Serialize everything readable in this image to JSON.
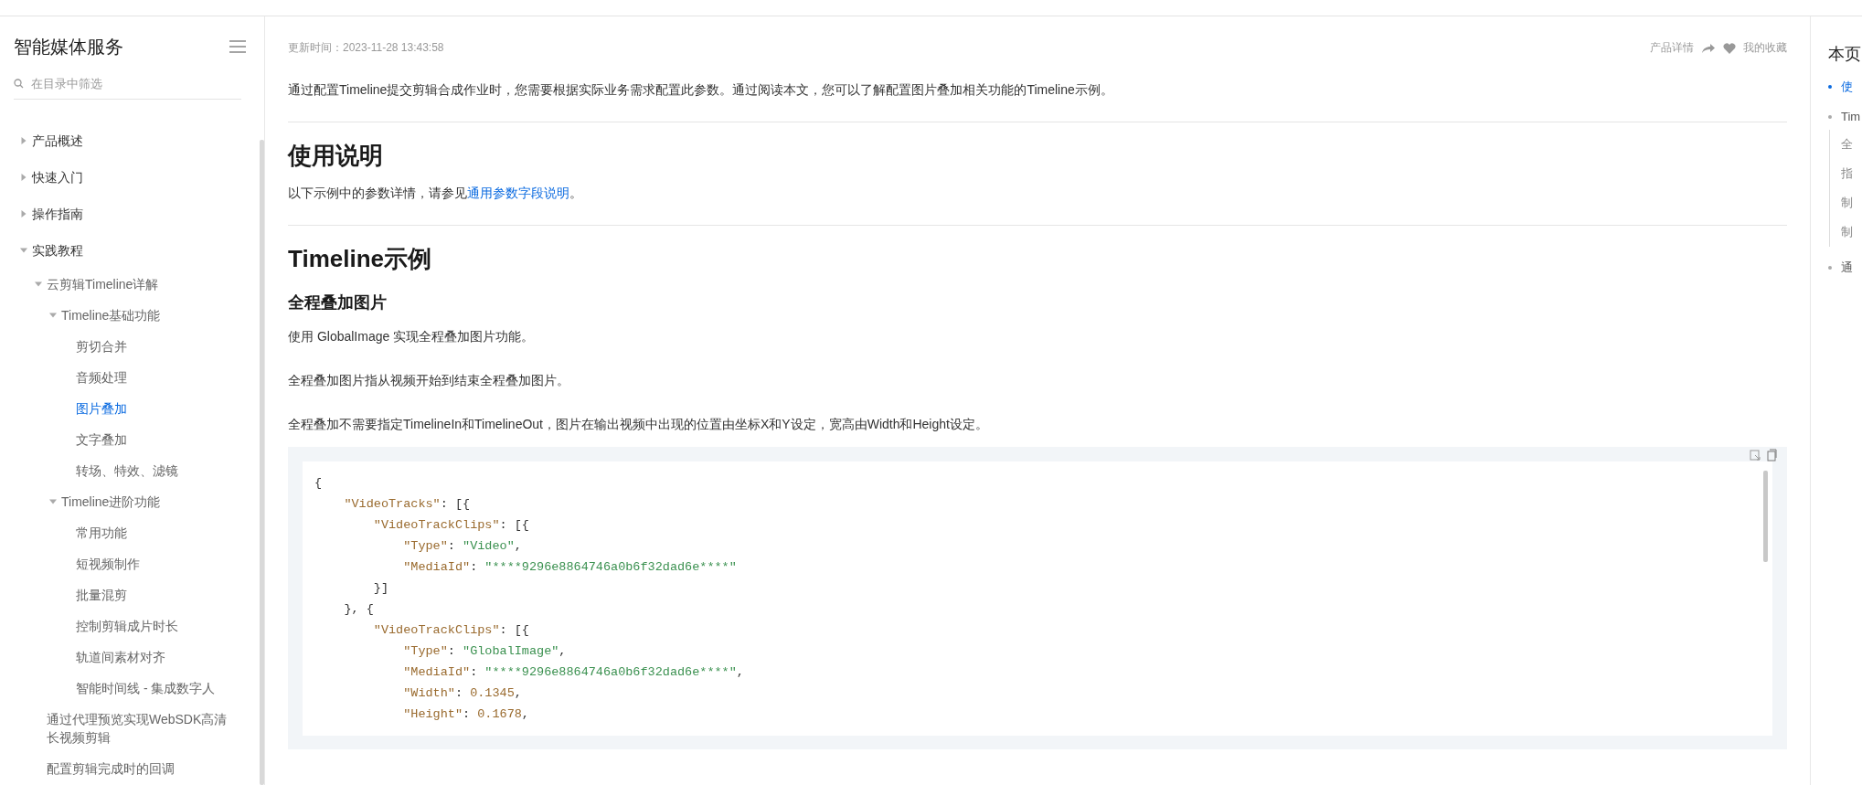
{
  "sidebar": {
    "title": "智能媒体服务",
    "filter": {
      "placeholder": "在目录中筛选"
    },
    "tree": [
      {
        "label": "产品概述",
        "expanded": false,
        "selected": false
      },
      {
        "label": "快速入门",
        "expanded": false,
        "selected": false
      },
      {
        "label": "操作指南",
        "expanded": false,
        "selected": false
      },
      {
        "label": "实践教程",
        "expanded": true,
        "selected": false,
        "children": [
          {
            "label": "云剪辑Timeline详解",
            "expanded": true,
            "selected": false,
            "children": [
              {
                "label": "Timeline基础功能",
                "expanded": true,
                "selected": false,
                "children": [
                  {
                    "label": "剪切合并",
                    "selected": false
                  },
                  {
                    "label": "音频处理",
                    "selected": false
                  },
                  {
                    "label": "图片叠加",
                    "selected": true
                  },
                  {
                    "label": "文字叠加",
                    "selected": false
                  },
                  {
                    "label": "转场、特效、滤镜",
                    "selected": false
                  }
                ]
              },
              {
                "label": "Timeline进阶功能",
                "expanded": true,
                "selected": false,
                "children": [
                  {
                    "label": "常用功能",
                    "selected": false
                  },
                  {
                    "label": "短视频制作",
                    "selected": false
                  },
                  {
                    "label": "批量混剪",
                    "selected": false
                  },
                  {
                    "label": "控制剪辑成片时长",
                    "selected": false
                  },
                  {
                    "label": "轨道间素材对齐",
                    "selected": false
                  },
                  {
                    "label": "智能时间线 - 集成数字人",
                    "selected": false
                  }
                ]
              }
            ]
          },
          {
            "label": "通过代理预览实现WebSDK高清长视频剪辑",
            "selected": false
          },
          {
            "label": "配置剪辑完成时的回调",
            "selected": false
          }
        ]
      }
    ]
  },
  "article": {
    "updated": "更新时间：2023-11-28 13:43:58",
    "actions": {
      "product_details": "产品详情",
      "favorites": "我的收藏"
    },
    "blocks": [
      {
        "kind": "paragraph",
        "text": "通过配置Timeline提交剪辑合成作业时，您需要根据实际业务需求配置此参数。通过阅读本文，您可以了解配置图片叠加相关功能的Timeline示例。"
      },
      {
        "kind": "rule"
      },
      {
        "kind": "h2",
        "text": "使用说明"
      },
      {
        "kind": "link_paragraph",
        "before": "以下示例中的参数详情，请参见",
        "link": "通用参数字段说明",
        "after": "。"
      },
      {
        "kind": "rule"
      },
      {
        "kind": "h2",
        "text": "Timeline示例"
      },
      {
        "kind": "h3",
        "text": "全程叠加图片"
      },
      {
        "kind": "paragraph",
        "text": "使用 GlobalImage 实现全程叠加图片功能。"
      },
      {
        "kind": "paragraph",
        "text": "全程叠加图片指从视频开始到结束全程叠加图片。"
      },
      {
        "kind": "paragraph",
        "text": "全程叠加不需要指定TimelineIn和TimelineOut，图片在输出视频中出现的位置由坐标X和Y设定，宽高由Width和Height设定。"
      },
      {
        "kind": "code",
        "lines": [
          [
            {
              "kind": "punct",
              "text": "{"
            }
          ],
          [
            {
              "kind": "key",
              "text": "    \"VideoTracks\""
            },
            {
              "kind": "punct",
              "text": ": [{"
            }
          ],
          [
            {
              "kind": "key",
              "text": "        \"VideoTrackClips\""
            },
            {
              "kind": "punct",
              "text": ": [{"
            }
          ],
          [
            {
              "kind": "key",
              "text": "            \"Type\""
            },
            {
              "kind": "punct",
              "text": ": "
            },
            {
              "kind": "string",
              "text": "\"Video\""
            },
            {
              "kind": "punct",
              "text": ","
            }
          ],
          [
            {
              "kind": "key",
              "text": "            \"MediaId\""
            },
            {
              "kind": "punct",
              "text": ": "
            },
            {
              "kind": "string",
              "text": "\"****9296e8864746a0b6f32dad6e****\""
            }
          ],
          [
            {
              "kind": "punct",
              "text": "        }]"
            }
          ],
          [
            {
              "kind": "punct",
              "text": "    }, {"
            }
          ],
          [
            {
              "kind": "key",
              "text": "        \"VideoTrackClips\""
            },
            {
              "kind": "punct",
              "text": ": [{"
            }
          ],
          [
            {
              "kind": "key",
              "text": "            \"Type\""
            },
            {
              "kind": "punct",
              "text": ": "
            },
            {
              "kind": "string",
              "text": "\"GlobalImage\""
            },
            {
              "kind": "punct",
              "text": ","
            }
          ],
          [
            {
              "kind": "key",
              "text": "            \"MediaId\""
            },
            {
              "kind": "punct",
              "text": ": "
            },
            {
              "kind": "string",
              "text": "\"****9296e8864746a0b6f32dad6e****\""
            },
            {
              "kind": "punct",
              "text": ","
            }
          ],
          [
            {
              "kind": "key",
              "text": "            \"Width\""
            },
            {
              "kind": "punct",
              "text": ": "
            },
            {
              "kind": "number",
              "text": "0.1345"
            },
            {
              "kind": "punct",
              "text": ","
            }
          ],
          [
            {
              "kind": "key",
              "text": "            \"Height\""
            },
            {
              "kind": "punct",
              "text": ": "
            },
            {
              "kind": "number",
              "text": "0.1678"
            },
            {
              "kind": "punct",
              "text": ","
            }
          ]
        ]
      }
    ]
  },
  "toc": {
    "title": "本页",
    "items": [
      {
        "label": "使",
        "selected": true
      },
      {
        "label": "Tim",
        "selected": false,
        "children": [
          {
            "label": "全",
            "selected": false
          },
          {
            "label": "指",
            "selected": false
          },
          {
            "label": "制",
            "selected": false
          },
          {
            "label": "制",
            "selected": false
          }
        ]
      },
      {
        "label": "通",
        "selected": false
      }
    ]
  }
}
